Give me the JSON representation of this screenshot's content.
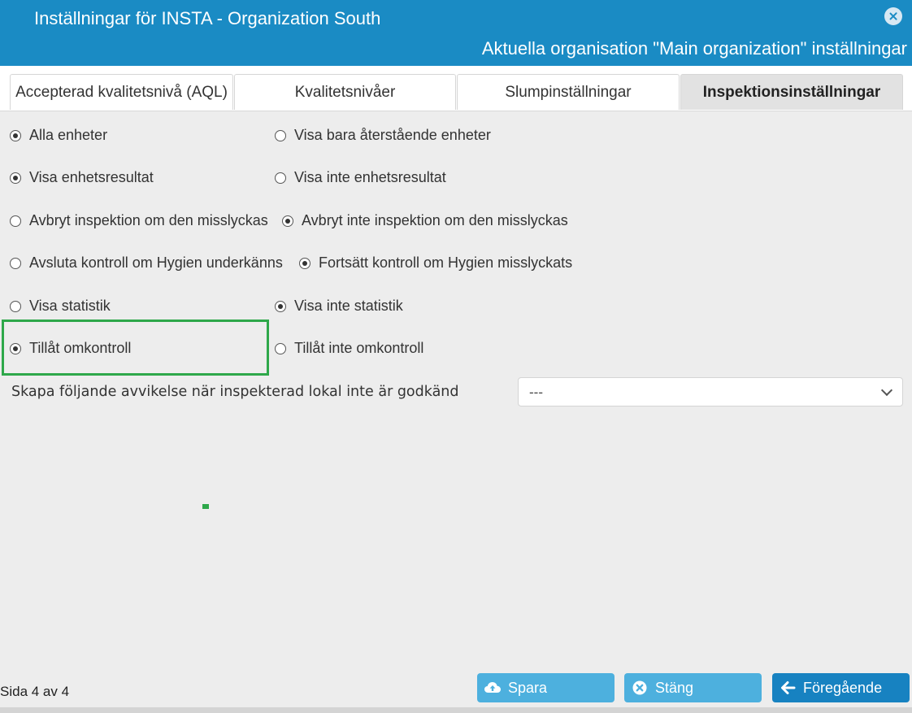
{
  "window": {
    "title": "Inställningar för INSTA - Organization South",
    "subtitle": "Aktuella organisation \"Main organization\" inställningar"
  },
  "tabs": [
    {
      "label": "Accepterad kvalitetsnivå (AQL)",
      "active": false
    },
    {
      "label": "Kvalitetsnivåer",
      "active": false
    },
    {
      "label": "Slumpinställningar",
      "active": false
    },
    {
      "label": "Inspektionsinställningar",
      "active": true
    }
  ],
  "settings": [
    {
      "option_a": "Alla enheter",
      "option_b": "Visa bara återstående enheter",
      "selected": "a"
    },
    {
      "option_a": "Visa enhetsresultat",
      "option_b": "Visa inte enhetsresultat",
      "selected": "a"
    },
    {
      "option_a": "Avbryt inspektion om den misslyckas",
      "option_b": "Avbryt inte inspektion om den misslyckas",
      "selected": "b"
    },
    {
      "option_a": "Avsluta kontroll om Hygien underkänns",
      "option_b": "Fortsätt kontroll om Hygien misslyckats",
      "selected": "b"
    },
    {
      "option_a": "Visa statistik",
      "option_b": "Visa inte statistik",
      "selected": "b"
    },
    {
      "option_a": "Tillåt omkontroll",
      "option_b": "Tillåt inte omkontroll",
      "selected": "a"
    }
  ],
  "deviation": {
    "label": "Skapa följande avvikelse när inspekterad lokal inte är godkänd",
    "value": "---"
  },
  "footer": {
    "page_info": "Sida 4 av 4",
    "save_label": "Spara",
    "close_label": "Stäng",
    "previous_label": "Föregående"
  },
  "colors": {
    "header": "#1a8bc4",
    "button_light": "#4db0de",
    "button_dark": "#1782c1",
    "highlight": "#2ea84a"
  },
  "icons": {
    "close": "close-circle-icon",
    "save": "cloud-upload-icon",
    "cancel": "x-circle-icon",
    "previous": "arrow-left-icon"
  }
}
